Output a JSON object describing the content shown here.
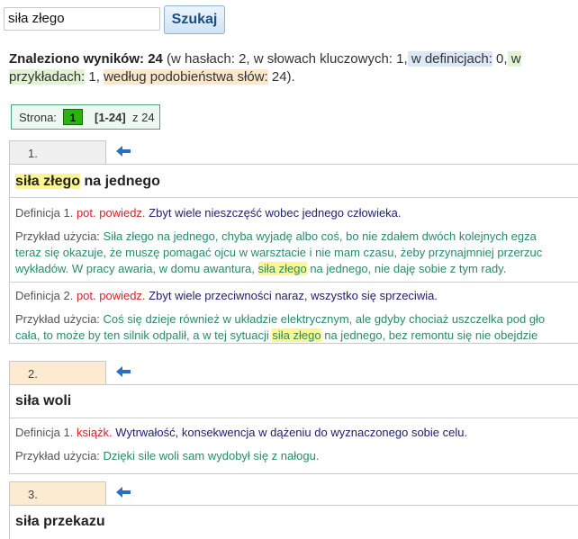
{
  "search": {
    "query": "siła złego",
    "button_label": "Szukaj"
  },
  "summary": {
    "label": "Znaleziono wyników:",
    "count": "24",
    "part1": " (w hasłach: 2, w słowach kluczowych: 1,",
    "def_label": " w definicjach:",
    "def_count": " 0,",
    "ex_label": " w",
    "part2": "przykładach:",
    "ex_count": " 1, ",
    "sim_label": "według podobieństwa słów:",
    "sim_count": " 24)."
  },
  "pager": {
    "label": "Strona:",
    "current": "1",
    "range": "[1-24]",
    "of": "z 24"
  },
  "entries": [
    {
      "number": "1.",
      "head_hl": "siła złego",
      "head_rest": " na jednego",
      "def1_label": "Definicja 1.",
      "def1_qual": "pot. powiedz.",
      "def1_text": "Zbyt wiele nieszczęść wobec jednego człowieka.",
      "ex1_label": "Przykład użycia:",
      "ex1_line1": "Siła złego na jednego, chyba wyjadę albo coś, bo nie zdałem dwóch kolejnych egza",
      "ex1_line2": "teraz się okazuje, że muszę pomagać ojcu w warsztacie i nie mam czasu, żeby przynajmniej przerzuc",
      "ex1_line3a": "wykładów. W pracy awaria, w domu awantura, ",
      "ex1_line3hl": "siła złego",
      "ex1_line3b": " na jednego, nie daję sobie z tym rady.",
      "def2_label": "Definicja 2.",
      "def2_qual": "pot. powiedz.",
      "def2_text": "Zbyt wiele przeciwności naraz, wszystko się sprzeciwia.",
      "ex2_label": "Przykład użycia:",
      "ex2_line1": "Coś się dzieje również w układzie elektrycznym, ale gdyby chociaż uszczelka pod gło",
      "ex2_line2a": "cała, to może by ten silnik odpalił, a w tej sytuacji ",
      "ex2_line2hl": "siła złego",
      "ex2_line2b": " na jednego, bez remontu się nie obejdzie"
    },
    {
      "number": "2.",
      "head": "siła woli",
      "def1_label": "Definicja 1.",
      "def1_qual": "książk.",
      "def1_text": "Wytrwałość, konsekwencja w dążeniu do wyznaczonego sobie celu.",
      "ex1_label": "Przykład użycia:",
      "ex1_text": "Dzięki sile woli sam wydobył się z nałogu."
    },
    {
      "number": "3.",
      "head": "siła przekazu"
    }
  ]
}
